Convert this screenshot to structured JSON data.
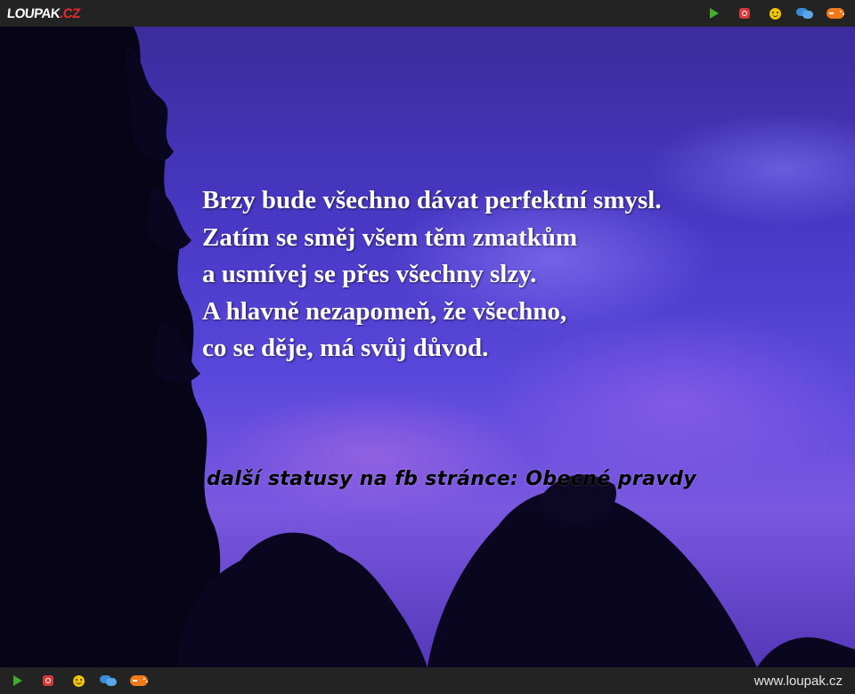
{
  "header": {
    "logo_main": "LOUPAK",
    "logo_suffix": ".CZ"
  },
  "icons": [
    "play-icon",
    "instagram-icon",
    "smile-icon",
    "chat-icon",
    "gamepad-icon"
  ],
  "image": {
    "quote_lines": [
      "Brzy bude všechno dávat perfektní smysl.",
      "Zatím se směj všem těm zmatkům",
      "a usmívej se přes všechny slzy.",
      "A hlavně nezapomeň, že všechno,",
      "co se děje, má svůj důvod."
    ],
    "promo": "další statusy na fb stránce: Obecné pravdy"
  },
  "footer": {
    "site_url": "www.loupak.cz"
  },
  "colors": {
    "bar": "#232323",
    "accent_red": "#e52b2b",
    "sky": "#4838c4"
  }
}
